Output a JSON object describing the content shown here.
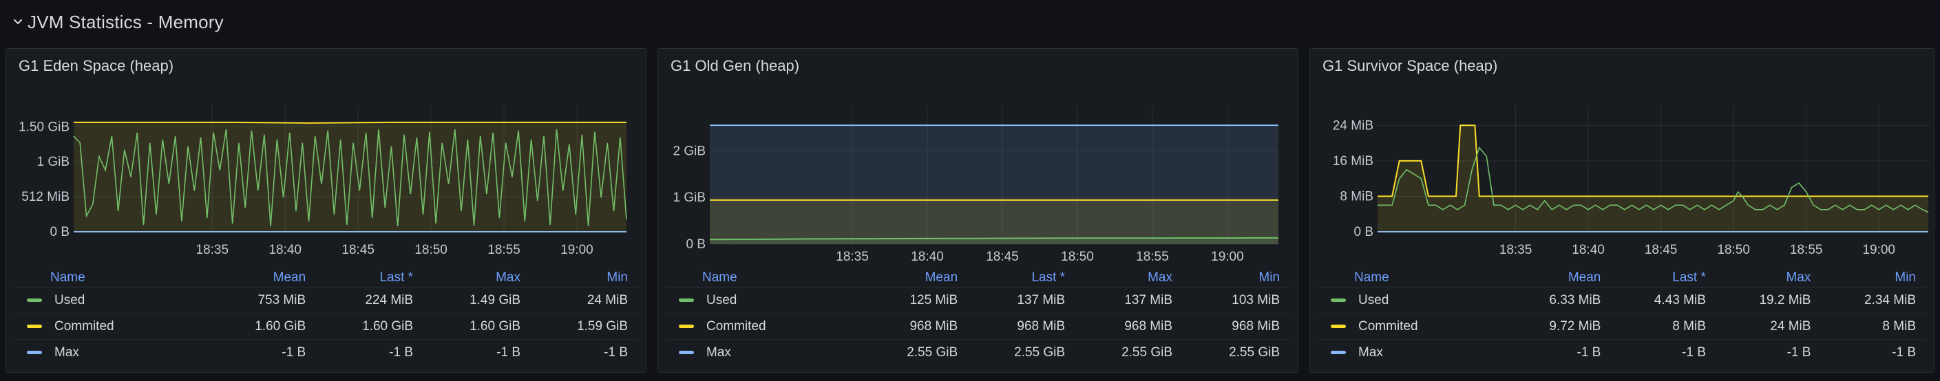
{
  "row": {
    "title": "JVM Statistics - Memory"
  },
  "panels": [
    {
      "title": "G1 Eden Space (heap)",
      "legend": {
        "headers": [
          "Name",
          "Mean",
          "Last *",
          "Max",
          "Min"
        ],
        "rows": [
          {
            "name": "Used",
            "color": "#73bf69",
            "values": [
              "753 MiB",
              "224 MiB",
              "1.49 GiB",
              "24 MiB"
            ]
          },
          {
            "name": "Commited",
            "color": "#fade2a",
            "values": [
              "1.60 GiB",
              "1.60 GiB",
              "1.60 GiB",
              "1.59 GiB"
            ]
          },
          {
            "name": "Max",
            "color": "#8ab8ff",
            "values": [
              "-1 B",
              "-1 B",
              "-1 B",
              "-1 B"
            ]
          }
        ]
      },
      "chart_data": {
        "type": "line",
        "y_ticks": [
          {
            "v": 0,
            "label": "0 B"
          },
          {
            "v": 512,
            "label": "512 MiB"
          },
          {
            "v": 1024,
            "label": "1 GiB"
          },
          {
            "v": 1536,
            "label": "1.50 GiB"
          }
        ],
        "ylim": [
          0,
          1750
        ],
        "x_ticks": [
          "18:35",
          "18:40",
          "18:45",
          "18:50",
          "18:55",
          "19:00"
        ],
        "x_ticks_at": [
          43,
          48,
          53,
          58,
          63,
          68
        ],
        "xlim": [
          33.5,
          71.4
        ],
        "series": [
          {
            "name": "Used",
            "color": "#73bf69",
            "fill": false,
            "y": [
              1400,
              1300,
              230,
              400,
              1100,
              900,
              1400,
              300,
              1200,
              800,
              1450,
              100,
              1300,
              250,
              1350,
              700,
              1400,
              150,
              1250,
              600,
              1380,
              200,
              1450,
              900,
              1500,
              120,
              1300,
              350,
              1480,
              600,
              1420,
              80,
              1350,
              500,
              1450,
              300,
              1300,
              150,
              1400,
              700,
              1480,
              250,
              1350,
              100,
              1300,
              600,
              1450,
              200,
              1500,
              350,
              1250,
              80,
              1420,
              550,
              1380,
              250,
              1460,
              120,
              1300,
              700,
              1500,
              300,
              1350,
              90,
              1400,
              550,
              1450,
              200,
              1300,
              800,
              1480,
              150,
              1350,
              450,
              1400,
              100,
              1500,
              600,
              1280,
              250,
              1420,
              80,
              1460,
              500,
              1300,
              300,
              1380,
              180
            ]
          },
          {
            "name": "Commited",
            "color": "#fade2a",
            "fill": true,
            "y": [
              1600,
              1600,
              1600,
              1590,
              1600,
              1600,
              1600,
              1600
            ]
          },
          {
            "name": "Max",
            "color": "#8ab8ff",
            "fill": false,
            "y": [
              -1,
              -1
            ]
          }
        ]
      }
    },
    {
      "title": "G1 Old Gen (heap)",
      "legend": {
        "headers": [
          "Name",
          "Mean",
          "Last *",
          "Max",
          "Min"
        ],
        "rows": [
          {
            "name": "Used",
            "color": "#73bf69",
            "values": [
              "125 MiB",
              "137 MiB",
              "137 MiB",
              "103 MiB"
            ]
          },
          {
            "name": "Commited",
            "color": "#fade2a",
            "values": [
              "968 MiB",
              "968 MiB",
              "968 MiB",
              "968 MiB"
            ]
          },
          {
            "name": "Max",
            "color": "#8ab8ff",
            "values": [
              "2.55 GiB",
              "2.55 GiB",
              "2.55 GiB",
              "2.55 GiB"
            ]
          }
        ]
      },
      "chart_data": {
        "type": "line",
        "y_ticks": [
          {
            "v": 0,
            "label": "0 B"
          },
          {
            "v": 1024,
            "label": "1 GiB"
          },
          {
            "v": 2048,
            "label": "2 GiB"
          }
        ],
        "ylim": [
          0,
          2900
        ],
        "x_ticks": [
          "18:35",
          "18:40",
          "18:45",
          "18:50",
          "18:55",
          "19:00"
        ],
        "x_ticks_at": [
          43,
          48,
          53,
          58,
          63,
          68
        ],
        "xlim": [
          33.5,
          71.4
        ],
        "series": [
          {
            "name": "Used",
            "color": "#73bf69",
            "fill": true,
            "y": [
              103,
              105,
              110,
              115,
              118,
              120,
              122,
              124,
              126,
              128,
              130,
              131,
              132,
              133,
              134,
              135,
              136,
              137
            ]
          },
          {
            "name": "Commited",
            "color": "#fade2a",
            "fill": true,
            "y": [
              968,
              968
            ]
          },
          {
            "name": "Max",
            "color": "#8ab8ff",
            "fill": true,
            "y": [
              2611,
              2611
            ]
          }
        ]
      }
    },
    {
      "title": "G1 Survivor Space (heap)",
      "legend": {
        "headers": [
          "Name",
          "Mean",
          "Last *",
          "Max",
          "Min"
        ],
        "rows": [
          {
            "name": "Used",
            "color": "#73bf69",
            "values": [
              "6.33 MiB",
              "4.43 MiB",
              "19.2 MiB",
              "2.34 MiB"
            ]
          },
          {
            "name": "Commited",
            "color": "#fade2a",
            "values": [
              "9.72 MiB",
              "8 MiB",
              "24 MiB",
              "8 MiB"
            ]
          },
          {
            "name": "Max",
            "color": "#8ab8ff",
            "values": [
              "-1 B",
              "-1 B",
              "-1 B",
              "-1 B"
            ]
          }
        ]
      },
      "chart_data": {
        "type": "line",
        "y_ticks": [
          {
            "v": 0,
            "label": "0 B"
          },
          {
            "v": 8,
            "label": "8 MiB"
          },
          {
            "v": 16,
            "label": "16 MiB"
          },
          {
            "v": 24,
            "label": "24 MiB"
          }
        ],
        "ylim": [
          0,
          27
        ],
        "x_ticks": [
          "18:35",
          "18:40",
          "18:45",
          "18:50",
          "18:55",
          "19:00"
        ],
        "x_ticks_at": [
          43,
          48,
          53,
          58,
          63,
          68
        ],
        "xlim": [
          33.5,
          71.4
        ],
        "series": [
          {
            "name": "Used",
            "color": "#73bf69",
            "fill": false,
            "x": [
              33.5,
              34,
              34.5,
              35,
              35.5,
              36,
              36.5,
              37,
              37.5,
              38,
              38.5,
              39,
              39.5,
              40,
              40.5,
              41,
              41.5,
              42,
              42.5,
              43,
              43.5,
              44,
              44.5,
              45,
              45.5,
              46,
              46.5,
              47,
              47.5,
              48,
              48.5,
              49,
              49.5,
              50,
              50.5,
              51,
              51.5,
              52,
              52.5,
              53,
              53.5,
              54,
              54.5,
              55,
              55.5,
              56,
              56.5,
              57,
              57.5,
              58,
              58.3,
              58.6,
              59,
              59.5,
              60,
              60.5,
              61,
              61.5,
              62,
              62.5,
              63,
              63.5,
              64,
              64.5,
              65,
              65.5,
              66,
              66.5,
              67,
              67.5,
              68,
              68.5,
              69,
              69.5,
              70,
              70.5,
              71,
              71.4
            ],
            "y": [
              6,
              6,
              6,
              12,
              14,
              13,
              12,
              6,
              6,
              5,
              6,
              5,
              6,
              14,
              19,
              17,
              6,
              6,
              5,
              6,
              5,
              6,
              5,
              7,
              5,
              6,
              5,
              6,
              6,
              5,
              6,
              5,
              6,
              6,
              5,
              6,
              5,
              6,
              5,
              6,
              5,
              6,
              6,
              5,
              6,
              5,
              6,
              5,
              6,
              7,
              9,
              8,
              6,
              5,
              5,
              6,
              5,
              6,
              10,
              11,
              9,
              6,
              5,
              5,
              6,
              5,
              6,
              5,
              5,
              6,
              5,
              6,
              5,
              6,
              5,
              6,
              5,
              4.4
            ]
          },
          {
            "name": "Commited",
            "color": "#fade2a",
            "fill": true,
            "x": [
              33.5,
              34.5,
              35,
              36.5,
              37,
              38.9,
              39.2,
              40.2,
              40.5,
              71.4
            ],
            "y": [
              8,
              8,
              16,
              16,
              8,
              8,
              24,
              24,
              8,
              8
            ]
          },
          {
            "name": "Max",
            "color": "#8ab8ff",
            "fill": false,
            "y": [
              -1,
              -1
            ]
          }
        ]
      }
    }
  ]
}
